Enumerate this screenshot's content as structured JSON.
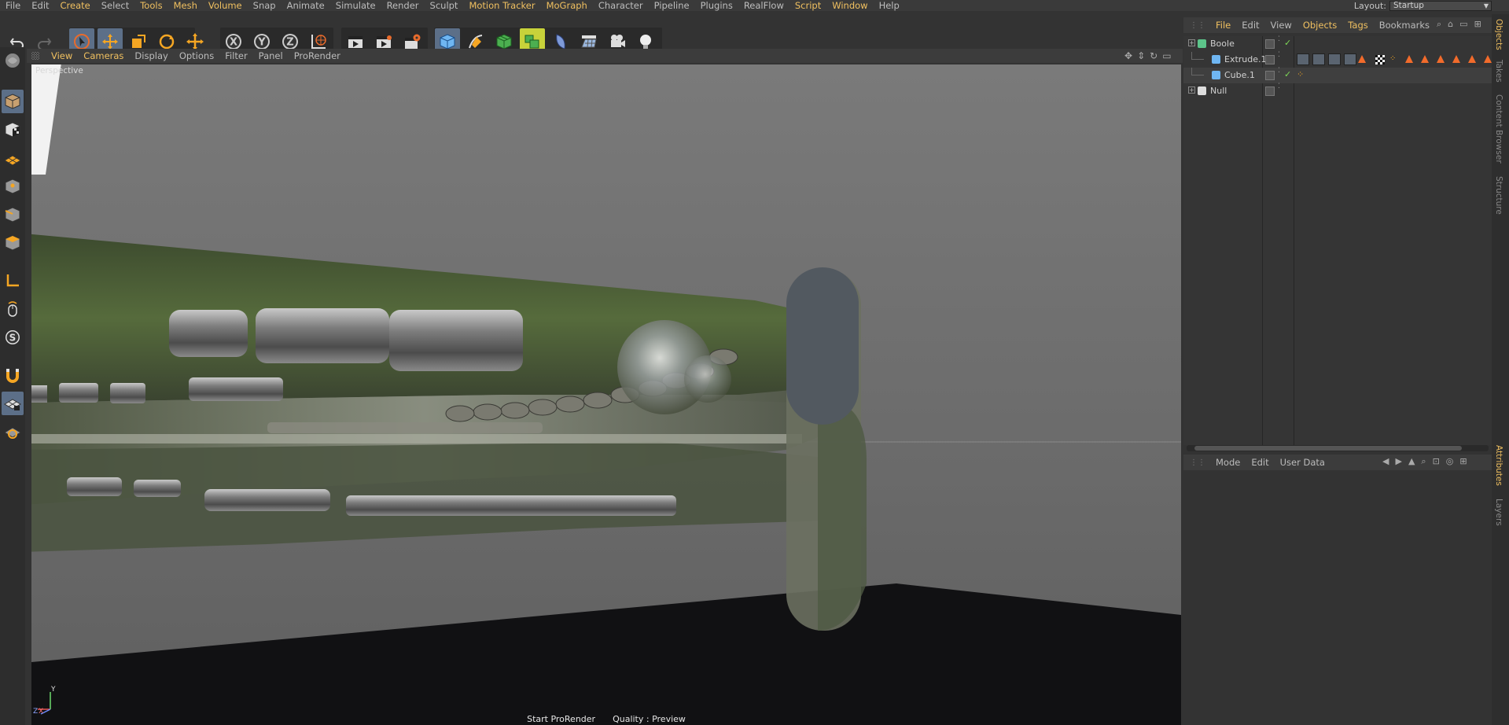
{
  "menubar": {
    "items": [
      "File",
      "Edit",
      "Create",
      "Select",
      "Tools",
      "Mesh",
      "Volume",
      "Snap",
      "Animate",
      "Simulate",
      "Render",
      "Sculpt",
      "Motion Tracker",
      "MoGraph",
      "Character",
      "Pipeline",
      "Plugins",
      "RealFlow",
      "Script",
      "Window",
      "Help"
    ],
    "highlighted": [
      "Create",
      "Tools",
      "Mesh",
      "Volume",
      "Motion Tracker",
      "MoGraph",
      "Script",
      "Window"
    ],
    "layout_label": "Layout:",
    "layout_value": "Startup"
  },
  "toolbar": {
    "icons": [
      "undo-icon",
      "redo-icon",
      "live-selection-icon",
      "move-icon",
      "scale-icon",
      "rotate-icon",
      "recent-tool-icon",
      "x-axis-lock-icon",
      "y-axis-lock-icon",
      "z-axis-lock-icon",
      "world-coordinates-icon",
      "render-view-icon",
      "render-picture-viewer-icon",
      "edit-render-settings-icon",
      "cube-icon",
      "pen-icon",
      "subdivision-icon",
      "array-icon",
      "deformer-icon",
      "floor-icon",
      "camera-icon",
      "light-icon"
    ],
    "axis_labels": [
      "X",
      "Y",
      "Z"
    ]
  },
  "left_toolbar": {
    "icons": [
      "make-editable-icon",
      "model-mode-icon",
      "texture-mode-icon",
      "workplane-icon",
      "points-mode-icon",
      "edges-mode-icon",
      "polygons-mode-icon",
      "axis-mode-icon",
      "tweak-mode-icon",
      "solo-icon",
      "snapping-icon",
      "workplane-lock-icon",
      "locked-workplane-icon"
    ],
    "solo_letter": "S"
  },
  "viewport": {
    "menu": [
      "View",
      "Cameras",
      "Display",
      "Options",
      "Filter",
      "Panel",
      "ProRender"
    ],
    "highlighted": [
      "View",
      "Cameras"
    ],
    "camera_label": "Perspective",
    "bottom": {
      "start_prorender": "Start ProRender",
      "quality": "Quality : Preview"
    },
    "axis": {
      "y": "Y",
      "z": "Z",
      "x": "X"
    }
  },
  "object_manager": {
    "menu": [
      "File",
      "Edit",
      "View",
      "Objects",
      "Tags",
      "Bookmarks"
    ],
    "highlighted": [
      "File",
      "Objects",
      "Tags"
    ],
    "objects": [
      {
        "name": "Boole",
        "level": 0
      },
      {
        "name": "Extrude.1",
        "level": 1
      },
      {
        "name": "Cube.1",
        "level": 1
      },
      {
        "name": "Null",
        "level": 0
      }
    ]
  },
  "attribute_manager": {
    "menu": [
      "Mode",
      "Edit",
      "User Data"
    ]
  },
  "side_tabs": {
    "top": [
      "Objects",
      "Takes",
      "Content Browser",
      "Structure"
    ],
    "bottom": [
      "Attributes",
      "Layers"
    ]
  },
  "colors": {
    "accent": "#f0c060",
    "selected_tool": "#5c6f88",
    "bg": "#333333"
  }
}
